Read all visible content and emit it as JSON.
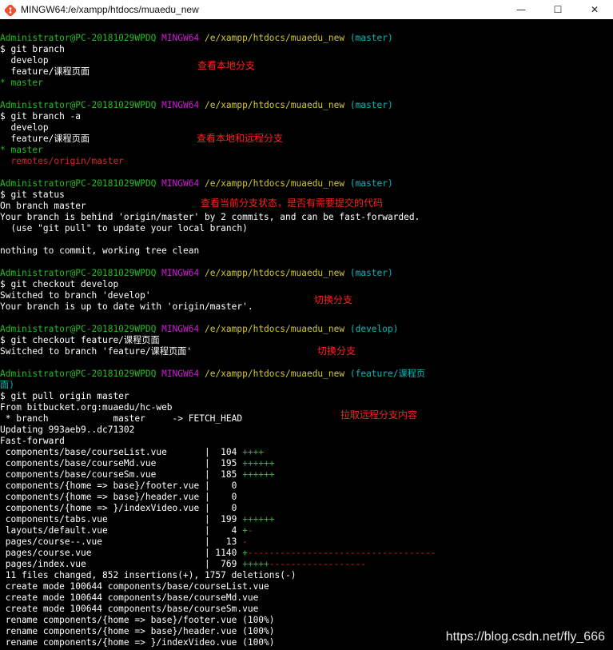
{
  "window": {
    "title": "MINGW64:/e/xampp/htdocs/muaedu_new",
    "icon": "git-bash-icon",
    "controls": {
      "minimize": "—",
      "maximize": "☐",
      "close": "✕"
    }
  },
  "colors": {
    "background": "#000000",
    "text": "#ffffff",
    "user_host": "#25bc24",
    "mingw": "#cb1ed1",
    "path": "#d2c92d",
    "branch": "#00bbbb",
    "current_branch": "#25bc24",
    "remote_branch": "#dd2222",
    "annotation": "#ff2020"
  },
  "terminal": {
    "lines": [
      [],
      [
        {
          "t": "Administrator@PC-20181029WPDQ",
          "c": "user_host"
        },
        {
          "t": " "
        },
        {
          "t": "MINGW64",
          "c": "mingw"
        },
        {
          "t": " "
        },
        {
          "t": "/e/xampp/htdocs/muaedu_new",
          "c": "path"
        },
        {
          "t": " "
        },
        {
          "t": "(master)",
          "c": "branch"
        }
      ],
      [
        {
          "t": "$ git branch"
        }
      ],
      [
        {
          "t": "  develop"
        }
      ],
      [
        {
          "t": "  feature/课程页面"
        }
      ],
      [
        {
          "t": "* master",
          "c": "current_branch"
        }
      ],
      [],
      [
        {
          "t": "Administrator@PC-20181029WPDQ",
          "c": "user_host"
        },
        {
          "t": " "
        },
        {
          "t": "MINGW64",
          "c": "mingw"
        },
        {
          "t": " "
        },
        {
          "t": "/e/xampp/htdocs/muaedu_new",
          "c": "path"
        },
        {
          "t": " "
        },
        {
          "t": "(master)",
          "c": "branch"
        }
      ],
      [
        {
          "t": "$ git branch -a"
        }
      ],
      [
        {
          "t": "  develop"
        }
      ],
      [
        {
          "t": "  feature/课程页面"
        }
      ],
      [
        {
          "t": "* master",
          "c": "current_branch"
        }
      ],
      [
        {
          "t": "  remotes/origin/master",
          "c": "remote_branch"
        }
      ],
      [],
      [
        {
          "t": "Administrator@PC-20181029WPDQ",
          "c": "user_host"
        },
        {
          "t": " "
        },
        {
          "t": "MINGW64",
          "c": "mingw"
        },
        {
          "t": " "
        },
        {
          "t": "/e/xampp/htdocs/muaedu_new",
          "c": "path"
        },
        {
          "t": " "
        },
        {
          "t": "(master)",
          "c": "branch"
        }
      ],
      [
        {
          "t": "$ git status"
        }
      ],
      [
        {
          "t": "On branch master"
        }
      ],
      [
        {
          "t": "Your branch is behind 'origin/master' by 2 commits, and can be fast-forwarded."
        }
      ],
      [
        {
          "t": "  (use \"git pull\" to update your local branch)"
        }
      ],
      [],
      [
        {
          "t": "nothing to commit, working tree clean"
        }
      ],
      [],
      [
        {
          "t": "Administrator@PC-20181029WPDQ",
          "c": "user_host"
        },
        {
          "t": " "
        },
        {
          "t": "MINGW64",
          "c": "mingw"
        },
        {
          "t": " "
        },
        {
          "t": "/e/xampp/htdocs/muaedu_new",
          "c": "path"
        },
        {
          "t": " "
        },
        {
          "t": "(master)",
          "c": "branch"
        }
      ],
      [
        {
          "t": "$ git checkout develop"
        }
      ],
      [
        {
          "t": "Switched to branch 'develop'"
        }
      ],
      [
        {
          "t": "Your branch is up to date with 'origin/master'."
        }
      ],
      [],
      [
        {
          "t": "Administrator@PC-20181029WPDQ",
          "c": "user_host"
        },
        {
          "t": " "
        },
        {
          "t": "MINGW64",
          "c": "mingw"
        },
        {
          "t": " "
        },
        {
          "t": "/e/xampp/htdocs/muaedu_new",
          "c": "path"
        },
        {
          "t": " "
        },
        {
          "t": "(develop)",
          "c": "branch"
        }
      ],
      [
        {
          "t": "$ git checkout feature/课程页面"
        }
      ],
      [
        {
          "t": "Switched to branch 'feature/课程页面'"
        }
      ],
      [],
      [
        {
          "t": "Administrator@PC-20181029WPDQ",
          "c": "user_host"
        },
        {
          "t": " "
        },
        {
          "t": "MINGW64",
          "c": "mingw"
        },
        {
          "t": " "
        },
        {
          "t": "/e/xampp/htdocs/muaedu_new",
          "c": "path"
        },
        {
          "t": " "
        },
        {
          "t": "(feature/课程页",
          "c": "branch"
        }
      ],
      [
        {
          "t": "面)",
          "c": "branch"
        }
      ],
      [
        {
          "t": "$ git pull origin master"
        }
      ],
      [
        {
          "t": "From bitbucket.org:muaedu/hc-web"
        }
      ],
      [
        {
          "t": " * branch            master     -> FETCH_HEAD"
        }
      ],
      [
        {
          "t": "Updating 993aeb9..dc71302"
        }
      ],
      [
        {
          "t": "Fast-forward"
        }
      ],
      [
        {
          "t": " components/base/courseList.vue       |  104 "
        },
        {
          "t": "++++",
          "c": "current_branch"
        }
      ],
      [
        {
          "t": " components/base/courseMd.vue         |  195 "
        },
        {
          "t": "++++++",
          "c": "current_branch"
        }
      ],
      [
        {
          "t": " components/base/courseSm.vue         |  185 "
        },
        {
          "t": "++++++",
          "c": "current_branch"
        }
      ],
      [
        {
          "t": " components/{home => base}/footer.vue |    0"
        }
      ],
      [
        {
          "t": " components/{home => base}/header.vue |    0"
        }
      ],
      [
        {
          "t": " components/{home => }/indexVideo.vue |    0"
        }
      ],
      [
        {
          "t": " components/tabs.vue                  |  199 "
        },
        {
          "t": "++++++",
          "c": "current_branch"
        }
      ],
      [
        {
          "t": " layouts/default.vue                  |    4 "
        },
        {
          "t": "+",
          "c": "current_branch"
        },
        {
          "t": "-",
          "c": "remote_branch"
        }
      ],
      [
        {
          "t": " pages/course--.vue                   |   13 "
        },
        {
          "t": "-",
          "c": "remote_branch"
        }
      ],
      [
        {
          "t": " pages/course.vue                     | 1140 "
        },
        {
          "t": "+",
          "c": "current_branch"
        },
        {
          "t": "-----------------------------------",
          "c": "remote_branch"
        }
      ],
      [
        {
          "t": " pages/index.vue                      |  769 "
        },
        {
          "t": "+++++",
          "c": "current_branch"
        },
        {
          "t": "------------------",
          "c": "remote_branch"
        }
      ],
      [
        {
          "t": " 11 files changed, 852 insertions(+), 1757 deletions(-)"
        }
      ],
      [
        {
          "t": " create mode 100644 components/base/courseList.vue"
        }
      ],
      [
        {
          "t": " create mode 100644 components/base/courseMd.vue"
        }
      ],
      [
        {
          "t": " create mode 100644 components/base/courseSm.vue"
        }
      ],
      [
        {
          "t": " rename components/{home => base}/footer.vue (100%)"
        }
      ],
      [
        {
          "t": " rename components/{home => base}/header.vue (100%)"
        }
      ],
      [
        {
          "t": " rename components/{home => }/indexVideo.vue (100%)"
        }
      ]
    ]
  },
  "annotations": [
    {
      "text": "查看本地分支"
    },
    {
      "text": "查看本地和远程分支"
    },
    {
      "text": "查看当前分支状态，是否有需要提交的代码"
    },
    {
      "text": "切换分支"
    },
    {
      "text": "切换分支"
    },
    {
      "text": "拉取远程分支内容"
    }
  ],
  "watermark": "https://blog.csdn.net/fly_666"
}
